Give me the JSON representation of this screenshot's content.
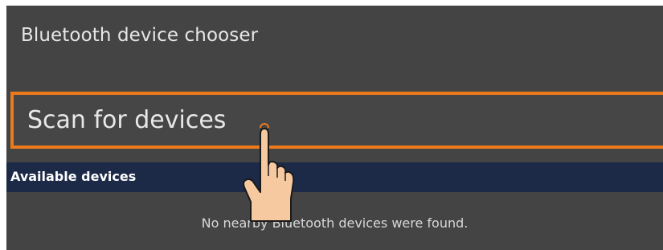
{
  "dialog": {
    "title": "Bluetooth device chooser",
    "scan_button_label": "Scan for devices",
    "section_header": "Available devices",
    "empty_message": "No nearby Bluetooth devices were found."
  },
  "colors": {
    "background": "#444444",
    "highlight": "#ec7a1c",
    "section_header_bg": "#1c2a47",
    "hand_skin": "#f6c9a0"
  },
  "icons": {
    "pointer": "tap-hand-icon"
  }
}
